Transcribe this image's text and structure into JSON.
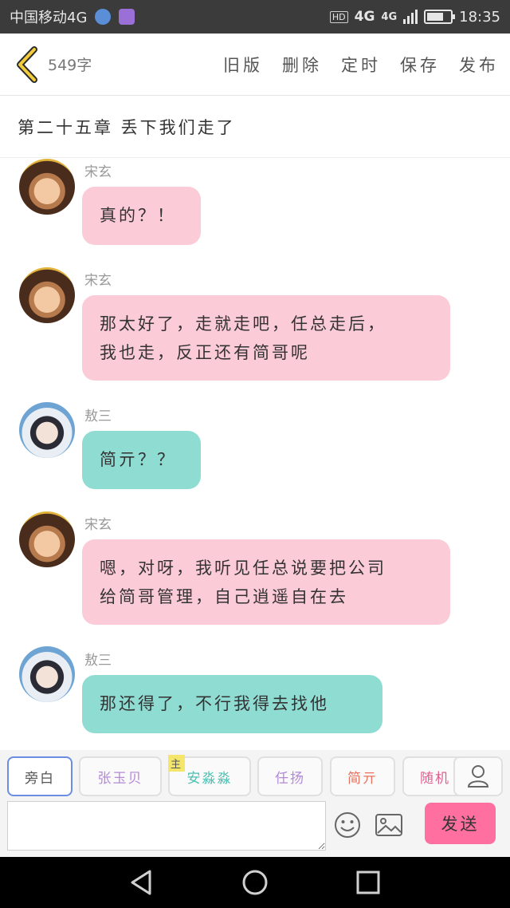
{
  "status_bar": {
    "carrier": "中国移动4G",
    "hd": "HD",
    "net1": "4G",
    "net2": "4G",
    "time": "18:35",
    "battery_level": 0.7
  },
  "toolbar": {
    "word_count": "549字",
    "actions": [
      "旧版",
      "删除",
      "定时",
      "保存",
      "发布"
    ]
  },
  "chapter_title": "第二十五章 丢下我们走了",
  "messages": [
    {
      "speaker": "宋玄",
      "text_lines": [
        "真的？！"
      ],
      "color": "#fccbd8"
    },
    {
      "speaker": "宋玄",
      "text_lines": [
        "那太好了，走就走吧，任总走后，",
        "我也走，反正还有简哥呢"
      ],
      "color": "#fccbd8"
    },
    {
      "speaker": "敖三",
      "text_lines": [
        "简亓？？"
      ],
      "color": "#8fdcd3"
    },
    {
      "speaker": "宋玄",
      "text_lines": [
        "嗯，对呀，我听见任总说要把公司",
        "给简哥管理，自己逍遥自在去"
      ],
      "color": "#fccbd8"
    },
    {
      "speaker": "敖三",
      "text_lines": [
        "那还得了，不行我得去找他"
      ],
      "color": "#8fdcd3"
    }
  ],
  "characters": [
    {
      "label": "旁白",
      "color": "#555555"
    },
    {
      "label": "张玉贝",
      "color": "#b48ad8"
    },
    {
      "label": "安淼淼",
      "color": "#4cbfb0",
      "badge": "主"
    },
    {
      "label": "任扬",
      "color": "#b48ad8"
    },
    {
      "label": "简亓",
      "color": "#e8725f"
    },
    {
      "label": "随机",
      "color": "#e05f8f"
    }
  ],
  "input": {
    "value": "",
    "send_label": "发送"
  },
  "colors": {
    "accent": "#ff6fa0",
    "pink_bubble": "#fccbd8",
    "teal_bubble": "#8fdcd3"
  }
}
